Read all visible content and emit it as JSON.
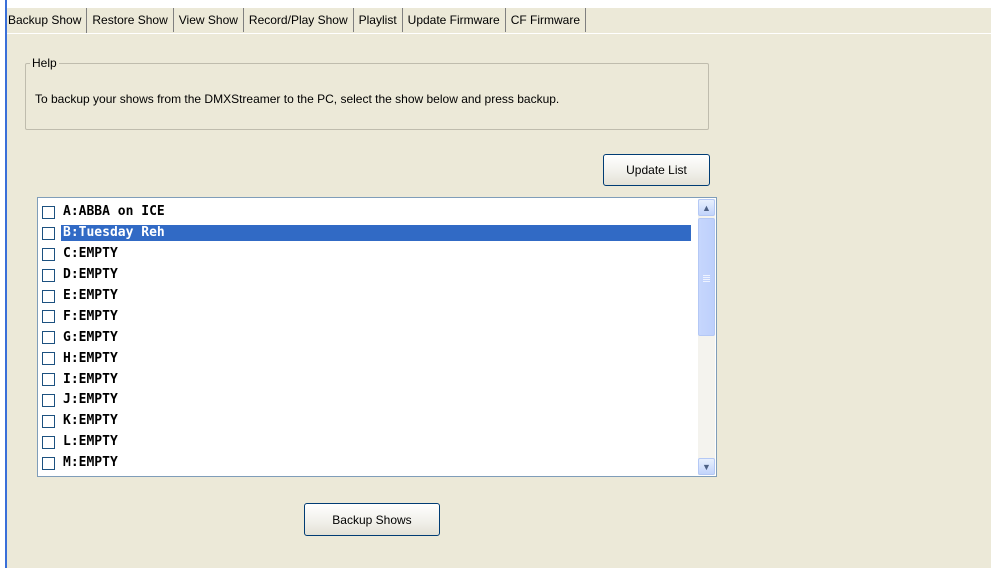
{
  "tabs": [
    {
      "label": "Backup Show",
      "active": true
    },
    {
      "label": "Restore Show",
      "active": false
    },
    {
      "label": "View Show",
      "active": false
    },
    {
      "label": "Record/Play Show",
      "active": false
    },
    {
      "label": "Playlist",
      "active": false
    },
    {
      "label": "Update Firmware",
      "active": false
    },
    {
      "label": "CF Firmware",
      "active": false
    }
  ],
  "help": {
    "caption": "Help",
    "text": "To backup your shows from the DMXStreamer to the PC, select the show below and press backup."
  },
  "buttons": {
    "update_list": "Update List",
    "backup_shows": "Backup Shows"
  },
  "shows": [
    {
      "label": "A:ABBA on ICE",
      "checked": false,
      "selected": false
    },
    {
      "label": "B:Tuesday Reh",
      "checked": false,
      "selected": true
    },
    {
      "label": "C:EMPTY",
      "checked": false,
      "selected": false
    },
    {
      "label": "D:EMPTY",
      "checked": false,
      "selected": false
    },
    {
      "label": "E:EMPTY",
      "checked": false,
      "selected": false
    },
    {
      "label": "F:EMPTY",
      "checked": false,
      "selected": false
    },
    {
      "label": "G:EMPTY",
      "checked": false,
      "selected": false
    },
    {
      "label": "H:EMPTY",
      "checked": false,
      "selected": false
    },
    {
      "label": "I:EMPTY",
      "checked": false,
      "selected": false
    },
    {
      "label": "J:EMPTY",
      "checked": false,
      "selected": false
    },
    {
      "label": "K:EMPTY",
      "checked": false,
      "selected": false
    },
    {
      "label": "L:EMPTY",
      "checked": false,
      "selected": false
    },
    {
      "label": "M:EMPTY",
      "checked": false,
      "selected": false
    }
  ],
  "colors": {
    "background": "#ece9d8",
    "selection": "#316ac5",
    "accent_edge": "#3a6fd8"
  },
  "icons": {
    "scroll_up": "chevron-up-icon",
    "scroll_down": "chevron-down-icon"
  }
}
